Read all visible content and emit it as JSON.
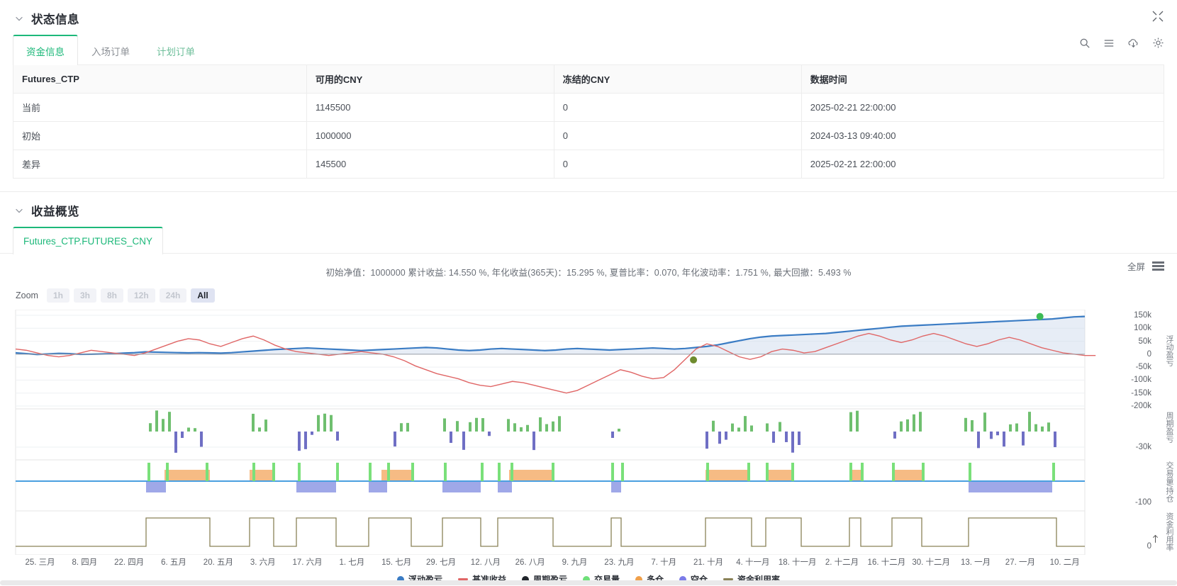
{
  "status_section": {
    "title": "状态信息",
    "chevron_icon": "chevron-down-icon",
    "expand_icon": "expand-icon",
    "tabs": [
      {
        "label": "资金信息",
        "active": true
      },
      {
        "label": "入场订单",
        "active": false
      },
      {
        "label": "计划订单",
        "active": false
      }
    ],
    "toolbar_icons": [
      "search-icon",
      "list-icon",
      "download-cloud-icon",
      "gear-icon"
    ],
    "table": {
      "headers": [
        "Futures_CTP",
        "可用的CNY",
        "冻结的CNY",
        "数据时间"
      ],
      "rows": [
        {
          "name": "当前",
          "name_style": "link",
          "available": "1145500",
          "frozen": "0",
          "time": "2025-02-21 22:00:00"
        },
        {
          "name": "初始",
          "name_style": "normal",
          "available": "1000000",
          "frozen": "0",
          "time": "2024-03-13 09:40:00"
        },
        {
          "name": "差异",
          "name_style": "warn",
          "available": "145500",
          "available_style": "warn",
          "frozen": "0",
          "time": "2025-02-21 22:00:00"
        }
      ]
    }
  },
  "overview_section": {
    "title": "收益概览",
    "chevron_icon": "chevron-down-icon",
    "tabs": [
      {
        "label": "Futures_CTP.FUTURES_CNY",
        "active": true
      }
    ]
  },
  "chart_header": {
    "stats_text": "初始净值：1000000 累计收益: 14.550 %, 年化收益(365天)：15.295 %, 夏普比率：0.070, 年化波动率：1.751 %, 最大回撤：5.493 %",
    "fullscreen_label": "全屏",
    "menu_icon": "hamburger-menu-icon"
  },
  "zoom_bar": {
    "label": "Zoom",
    "buttons": [
      {
        "label": "1h",
        "active": false
      },
      {
        "label": "3h",
        "active": false
      },
      {
        "label": "8h",
        "active": false
      },
      {
        "label": "12h",
        "active": false
      },
      {
        "label": "24h",
        "active": false
      },
      {
        "label": "All",
        "active": true
      }
    ]
  },
  "legend": [
    {
      "label": "浮动盈亏",
      "marker": "dot",
      "color": "#3b7cc4"
    },
    {
      "label": "基准收益",
      "marker": "line",
      "color": "#e06666"
    },
    {
      "label": "周期盈亏",
      "marker": "dot",
      "color": "#21252b"
    },
    {
      "label": "交易量",
      "marker": "dot",
      "color": "#6fe07a"
    },
    {
      "label": "多仓",
      "marker": "dot",
      "color": "#f0a04b"
    },
    {
      "label": "空仓",
      "marker": "dot",
      "color": "#7b7be8"
    },
    {
      "label": "资金利用率",
      "marker": "line",
      "color": "#8a8258"
    }
  ],
  "chart_data": {
    "type": "line",
    "title": "初始净值：1000000 累计收益: 14.550 %, 年化收益(365天)：15.295 %, 夏普比率：0.070, 年化波动率：1.751 %, 最大回撤：5.493 %",
    "xlabel": "",
    "x_tick_labels": [
      "25. 三月",
      "8. 四月",
      "22. 四月",
      "6. 五月",
      "20. 五月",
      "3. 六月",
      "17. 六月",
      "1. 七月",
      "15. 七月",
      "29. 七月",
      "12. 八月",
      "26. 八月",
      "9. 九月",
      "23. 九月",
      "7. 十月",
      "21. 十月",
      "4. 十一月",
      "18. 十一月",
      "2. 十二月",
      "16. 十二月",
      "30. 十二月",
      "13. 一月",
      "27. 一月",
      "10. 二月"
    ],
    "panes": [
      {
        "name": "浮动盈亏",
        "ylabel": "浮动盈亏",
        "y_ticks": [
          "150k",
          "100k",
          "50k",
          "0",
          "-50k",
          "-100k",
          "-150k",
          "-200k"
        ],
        "ylim": [
          -200000,
          150000
        ],
        "series": [
          {
            "name": "浮动盈亏",
            "color": "#3b7cc4",
            "type": "area-line",
            "values": [
              5000,
              2000,
              -1000,
              1000,
              3000,
              2000,
              -500,
              0,
              1000,
              2000,
              4000,
              6000,
              9000,
              8000,
              7000,
              6000,
              5000,
              6000,
              5000,
              4000,
              6000,
              9000,
              12000,
              15000,
              18000,
              20000,
              22000,
              24000,
              22000,
              20000,
              18000,
              16000,
              14000,
              16000,
              18000,
              20000,
              22000,
              24000,
              26000,
              24000,
              20000,
              16000,
              14000,
              16000,
              20000,
              22000,
              20000,
              18000,
              16000,
              14000,
              16000,
              20000,
              22000,
              20000,
              18000,
              16000,
              18000,
              20000,
              22000,
              24000,
              22000,
              20000,
              22000,
              26000,
              30000,
              36000,
              44000,
              52000,
              60000,
              66000,
              70000,
              72000,
              74000,
              76000,
              78000,
              80000,
              84000,
              88000,
              92000,
              96000,
              100000,
              104000,
              108000,
              110000,
              112000,
              114000,
              116000,
              118000,
              120000,
              122000,
              124000,
              126000,
              128000,
              130000,
              132000,
              134000,
              136000,
              140000,
              144000,
              145500
            ]
          },
          {
            "name": "基准收益",
            "color": "#e06666",
            "type": "line",
            "values": [
              20000,
              15000,
              5000,
              -5000,
              -10000,
              -5000,
              5000,
              15000,
              10000,
              5000,
              0,
              -5000,
              5000,
              20000,
              35000,
              50000,
              60000,
              55000,
              40000,
              30000,
              45000,
              60000,
              70000,
              55000,
              35000,
              20000,
              10000,
              5000,
              0,
              -5000,
              0,
              5000,
              10000,
              5000,
              0,
              -10000,
              -25000,
              -45000,
              -60000,
              -75000,
              -85000,
              -95000,
              -110000,
              -120000,
              -125000,
              -115000,
              -105000,
              -110000,
              -120000,
              -130000,
              -140000,
              -150000,
              -140000,
              -120000,
              -100000,
              -80000,
              -60000,
              -70000,
              -85000,
              -95000,
              -90000,
              -60000,
              -20000,
              20000,
              40000,
              30000,
              10000,
              -10000,
              -20000,
              -10000,
              10000,
              20000,
              15000,
              5000,
              10000,
              25000,
              40000,
              55000,
              70000,
              80000,
              70000,
              55000,
              45000,
              55000,
              70000,
              80000,
              70000,
              55000,
              40000,
              30000,
              40000,
              55000,
              65000,
              55000,
              40000,
              25000,
              15000,
              5000,
              0,
              -5000,
              -5000
            ]
          }
        ],
        "markers": [
          {
            "name": "current-value-dot",
            "color": "#3dbb55",
            "x_pct": 95.8,
            "value": 145500
          },
          {
            "name": "mid-point-dot",
            "color": "#6e8b2e",
            "x_pct": 63.4,
            "value": -22000
          }
        ]
      },
      {
        "name": "周期盈亏",
        "ylabel": "周期盈亏",
        "y_ticks": [
          "-30k"
        ],
        "type": "bar",
        "note": "green bars positive / purple bars negative, sparse clusters"
      },
      {
        "name": "交易量/持仓",
        "ylabel": "交易量/持仓",
        "y_ticks": [
          "-100"
        ],
        "type": "bar",
        "note": "orange long position blocks above baseline, purple short blocks below, green volume spikes"
      },
      {
        "name": "资金利用率",
        "ylabel": "资金利用率",
        "y_ticks": [
          "0"
        ],
        "type": "step",
        "color": "#8a8258",
        "note": "square-wave utilization steps"
      }
    ]
  }
}
